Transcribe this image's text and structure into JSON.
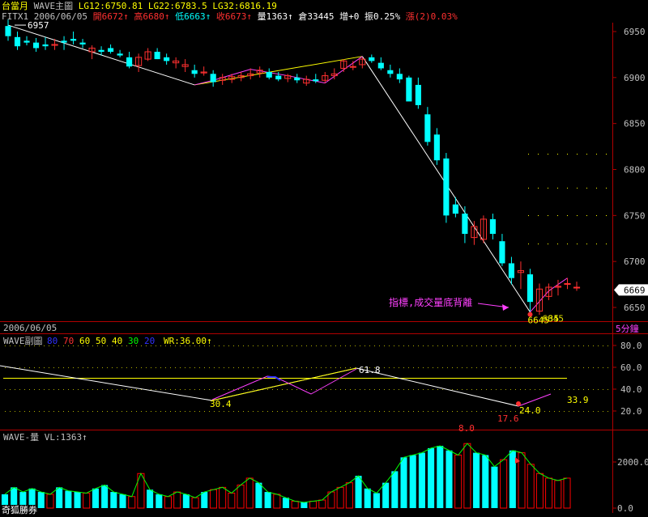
{
  "colors": {
    "background": "#000000",
    "up_candle": "#ff3030",
    "down_candle": "#00ffff",
    "wave_white": "#ffffff",
    "wave_yellow": "#ffff00",
    "wave_magenta": "#ff40ff",
    "frame_red": "#b00000",
    "label_yellow": "#ffff00",
    "axis_text": "#c0c0c0",
    "vol_green": "#00ff00",
    "vol_bar": "#00ffff",
    "vol_red": "#ff0000"
  },
  "header": {
    "line1": {
      "symbol": "台當月",
      "indicator": "WAVE主圖",
      "lg12": "LG12:6750.81",
      "lg22": "LG22:6783.5",
      "lg32": "LG32:6816.19"
    },
    "line2": {
      "code_date": "FITX1 2006/06/05",
      "open": "開6672↑",
      "high": "高6680↑",
      "low": "低6663↑",
      "close": "收6673↑",
      "volume": "量1363↑",
      "oi": "倉33445",
      "oi_change": "增+0",
      "amplitude": "振0.25%",
      "change": "漲(2)0.03%"
    }
  },
  "chart_data": [
    {
      "type": "candlestick",
      "panel": "main",
      "title": "WAVE主圖",
      "ylim": [
        6635,
        6975
      ],
      "yticks": [
        6650,
        6700,
        6750,
        6800,
        6850,
        6900,
        6950
      ],
      "current_price": "6669",
      "period": "5分鐘",
      "date_label": "2006/06/05",
      "candles": [
        [
          6956,
          6963,
          6940,
          6945
        ],
        [
          6944,
          6950,
          6930,
          6934
        ],
        [
          6940,
          6945,
          6935,
          6938
        ],
        [
          6938,
          6943,
          6928,
          6932
        ],
        [
          6936,
          6944,
          6930,
          6934
        ],
        [
          6935,
          6942,
          6930,
          6936
        ],
        [
          6940,
          6945,
          6930,
          6938
        ],
        [
          6942,
          6950,
          6936,
          6940
        ],
        [
          6938,
          6942,
          6932,
          6936
        ],
        [
          6928,
          6935,
          6920,
          6932
        ],
        [
          6930,
          6934,
          6924,
          6928
        ],
        [
          6932,
          6936,
          6926,
          6928
        ],
        [
          6926,
          6930,
          6922,
          6924
        ],
        [
          6922,
          6928,
          6910,
          6912
        ],
        [
          6913,
          6926,
          6906,
          6922
        ],
        [
          6920,
          6932,
          6918,
          6928
        ],
        [
          6928,
          6932,
          6920,
          6920
        ],
        [
          6922,
          6926,
          6914,
          6918
        ],
        [
          6916,
          6922,
          6910,
          6918
        ],
        [
          6912,
          6920,
          6906,
          6914
        ],
        [
          6908,
          6914,
          6900,
          6904
        ],
        [
          6905,
          6912,
          6902,
          6906
        ],
        [
          6904,
          6908,
          6890,
          6895
        ],
        [
          6897,
          6904,
          6892,
          6900
        ],
        [
          6898,
          6904,
          6894,
          6901
        ],
        [
          6900,
          6906,
          6896,
          6902
        ],
        [
          6902,
          6910,
          6898,
          6904
        ],
        [
          6905,
          6912,
          6900,
          6908
        ],
        [
          6906,
          6910,
          6898,
          6900
        ],
        [
          6902,
          6906,
          6896,
          6898
        ],
        [
          6899,
          6904,
          6895,
          6902
        ],
        [
          6900,
          6904,
          6894,
          6897
        ],
        [
          6894,
          6902,
          6891,
          6898
        ],
        [
          6898,
          6904,
          6894,
          6896
        ],
        [
          6897,
          6906,
          6894,
          6902
        ],
        [
          6902,
          6910,
          6898,
          6904
        ],
        [
          6910,
          6920,
          6906,
          6918
        ],
        [
          6912,
          6918,
          6908,
          6912
        ],
        [
          6914,
          6922,
          6910,
          6920
        ],
        [
          6922,
          6925,
          6916,
          6918
        ],
        [
          6916,
          6922,
          6908,
          6910
        ],
        [
          6908,
          6914,
          6900,
          6904
        ],
        [
          6904,
          6910,
          6894,
          6898
        ],
        [
          6900,
          6902,
          6880,
          6874
        ],
        [
          6892,
          6900,
          6866,
          6870
        ],
        [
          6860,
          6868,
          6826,
          6830
        ],
        [
          6838,
          6845,
          6805,
          6810
        ],
        [
          6812,
          6818,
          6742,
          6750
        ],
        [
          6762,
          6770,
          6748,
          6752
        ],
        [
          6752,
          6760,
          6720,
          6730
        ],
        [
          6726,
          6744,
          6718,
          6738
        ],
        [
          6724,
          6750,
          6720,
          6746
        ],
        [
          6746,
          6752,
          6724,
          6730
        ],
        [
          6722,
          6730,
          6695,
          6698
        ],
        [
          6698,
          6705,
          6675,
          6682
        ],
        [
          6688,
          6700,
          6670,
          6690
        ],
        [
          6686,
          6692,
          6646,
          6656
        ],
        [
          6646,
          6676,
          6642,
          6670
        ],
        [
          6662,
          6676,
          6658,
          6672
        ],
        [
          6672,
          6680,
          6663,
          6673
        ],
        [
          6676,
          6682,
          6670,
          6676
        ],
        [
          6672,
          6678,
          6668,
          6672
        ]
      ],
      "annotations": [
        {
          "text": "6957",
          "color": "#ffffff",
          "price": 6957
        },
        {
          "text": "指標,成交量底背離",
          "color": "#ff40ff",
          "price": 6660
        },
        {
          "text": "6645",
          "color": "#ffff00",
          "price": 6645
        },
        {
          "text": "3",
          "color": "#ffff00",
          "price": 6645
        },
        {
          "text": "5",
          "color": "#ffff00",
          "price": 6645
        },
        {
          "text": "6645",
          "color": "#ffff00",
          "price": 6645
        }
      ]
    },
    {
      "type": "line",
      "panel": "wr",
      "title": "WAVE副圖",
      "ylim": [
        10,
        90
      ],
      "yticks": [
        20.0,
        40.0,
        60.0,
        80.0
      ],
      "legend": [
        {
          "label": "80",
          "color": "#3030ff"
        },
        {
          "label": "70",
          "color": "#ff3030"
        },
        {
          "label": "60",
          "color": "#ffff00"
        },
        {
          "label": "50",
          "color": "#ffff00"
        },
        {
          "label": "40",
          "color": "#ffff00"
        },
        {
          "label": "30",
          "color": "#00ff00"
        },
        {
          "label": "20",
          "color": "#3030ff"
        }
      ],
      "wr_label": "WR:36.00↑",
      "reference_line": 50,
      "labels": [
        {
          "text": "30.4",
          "color": "#ffff00",
          "value": 30.4
        },
        {
          "text": "61.8",
          "color": "#ffffff",
          "value": 61.8
        },
        {
          "text": "8.0",
          "color": "#ff3030",
          "value": 8.0
        },
        {
          "text": "17.6",
          "color": "#ff3030",
          "value": 17.6
        },
        {
          "text": "24.0",
          "color": "#ffff00",
          "value": 24.0
        },
        {
          "text": "33.9",
          "color": "#ffff00",
          "value": 33.9
        }
      ]
    },
    {
      "type": "bar",
      "panel": "volume",
      "title": "WAVE-量",
      "vl_label": "VL:1363↑",
      "ylim": [
        0,
        3000
      ],
      "yticks": [
        0.0,
        2000.0
      ],
      "values": [
        600,
        900,
        700,
        850,
        700,
        600,
        900,
        750,
        700,
        650,
        850,
        1000,
        700,
        600,
        500,
        1500,
        800,
        600,
        500,
        700,
        600,
        450,
        700,
        800,
        900,
        650,
        1000,
        1300,
        1100,
        700,
        600,
        450,
        300,
        250,
        300,
        350,
        700,
        900,
        1100,
        1400,
        850,
        650,
        1100,
        1600,
        2200,
        2300,
        2400,
        2600,
        2700,
        2500,
        2300,
        2800,
        2400,
        2300,
        1800,
        2100,
        2500,
        2400,
        1900,
        1500,
        1300,
        1200,
        1300
      ]
    }
  ],
  "footer": {
    "brand": "奇狐勝券"
  }
}
